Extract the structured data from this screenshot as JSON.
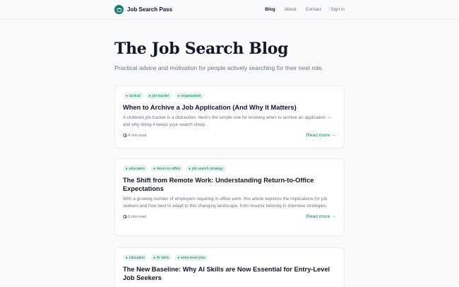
{
  "nav": {
    "brand": "Job Search Pass",
    "links": [
      "Blog",
      "About",
      "Contact",
      "Sign in"
    ]
  },
  "page": {
    "title": "The Job Search Blog",
    "subtitle": "Practical advice and motivation for people actively searching for their next role."
  },
  "posts": [
    {
      "tags": [
        "tactical",
        "job-tracker",
        "organization"
      ],
      "title": "When to Archive a Job Application (And Why It Matters)",
      "description": "A cluttered job tracker is a distraction. Here's the simple rule for knowing when to archive an application — and why doing it keeps your search sharp.",
      "read_time": "4 min read",
      "read_more": "Read more →"
    },
    {
      "tags": [
        "education",
        "return-to-office",
        "job search strategy"
      ],
      "title": "The Shift from Remote Work: Understanding Return-to-Office Expectations",
      "description": "With a growing number of employers requiring in-office work, this article explores the implications for job seekers and how best to adapt to this changing landscape, from resume tailoring to interview strategies.",
      "read_time": "6 min read",
      "read_more": "Read more →"
    },
    {
      "tags": [
        "education",
        "AI skills",
        "entry-level jobs"
      ],
      "title": "The New Baseline: Why AI Skills are Now Essential for Entry-Level Job Seekers"
    }
  ],
  "colors": {
    "accent": "#14806d",
    "tag_bg": "#e6f3ef",
    "background": "#f8fafc"
  },
  "icons": {
    "logo": "briefcase-icon",
    "tag": "tag-icon",
    "time": "clock-icon"
  }
}
